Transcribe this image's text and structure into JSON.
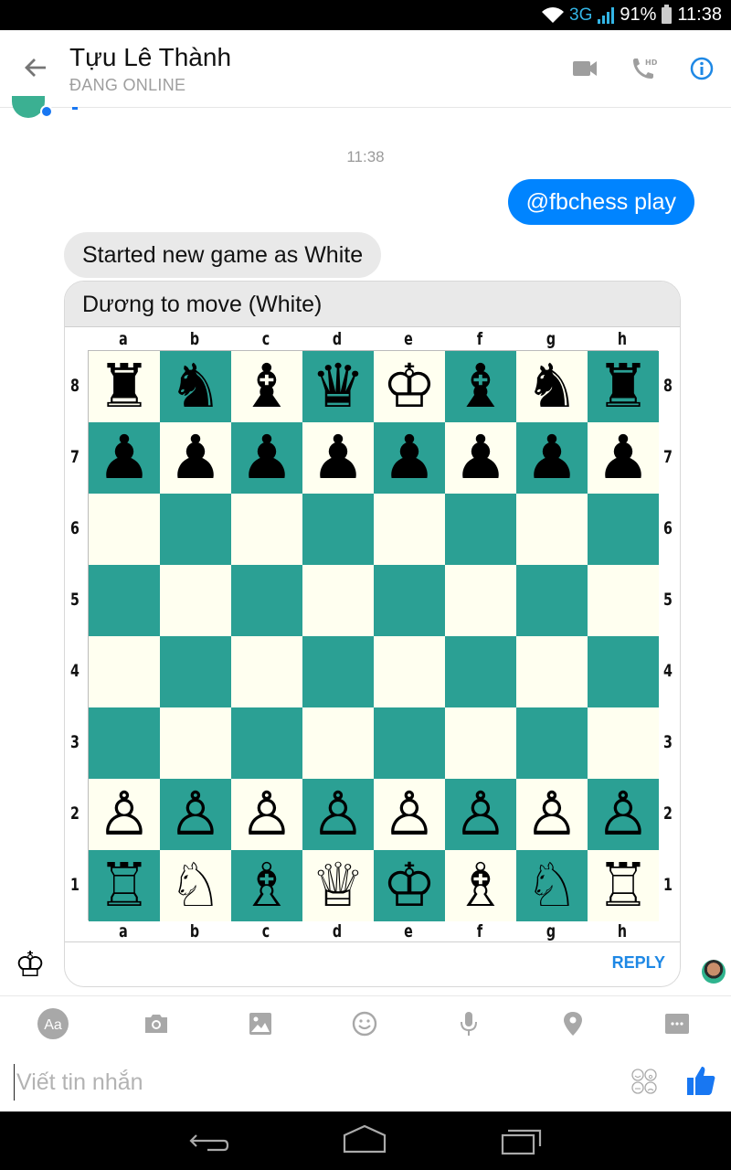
{
  "status_bar": {
    "network": "3G",
    "battery": "91%",
    "time": "11:38"
  },
  "header": {
    "title": "Tựu Lê Thành",
    "subtitle": "ĐANG ONLINE",
    "icons": [
      "back-arrow-icon",
      "video-call-icon",
      "hd-voice-call-icon",
      "info-icon"
    ],
    "accent": "#1e88e5"
  },
  "conversation": {
    "timestamp": "11:38",
    "messages": [
      {
        "from": "me",
        "text": "@fbchess play"
      },
      {
        "from": "bot",
        "text": "Started new game as White"
      }
    ],
    "chess_card": {
      "title": "Dương to move (White)",
      "files": [
        "a",
        "b",
        "c",
        "d",
        "e",
        "f",
        "g",
        "h"
      ],
      "ranks": [
        "8",
        "7",
        "6",
        "5",
        "4",
        "3",
        "2",
        "1"
      ],
      "board": [
        [
          "♜",
          "♞",
          "♝",
          "♛",
          "♔",
          "♝",
          "♞",
          "♜"
        ],
        [
          "♟",
          "♟",
          "♟",
          "♟",
          "♟",
          "♟",
          "♟",
          "♟"
        ],
        [
          "",
          "",
          "",
          "",
          "",
          "",
          "",
          ""
        ],
        [
          "",
          "",
          "",
          "",
          "",
          "",
          "",
          ""
        ],
        [
          "",
          "",
          "",
          "",
          "",
          "",
          "",
          ""
        ],
        [
          "",
          "",
          "",
          "",
          "",
          "",
          "",
          ""
        ],
        [
          "♙",
          "♙",
          "♙",
          "♙",
          "♙",
          "♙",
          "♙",
          "♙"
        ],
        [
          "♖",
          "♘",
          "♗",
          "♕",
          "♔",
          "♗",
          "♘",
          "♖"
        ]
      ],
      "light_square_color": "#fffff0",
      "dark_square_color": "#2ba094",
      "reply_label": "REPLY"
    },
    "sender_avatar_glyph": "♔"
  },
  "composer": {
    "tools": [
      "text-format-icon",
      "camera-icon",
      "gallery-icon",
      "emoji-icon",
      "microphone-icon",
      "location-icon",
      "more-icon"
    ],
    "tool_labels": {
      "text_format": "Aa"
    },
    "placeholder": "Viết tin nhắn",
    "value": ""
  },
  "colors": {
    "outgoing_bubble": "#0084ff",
    "incoming_bubble": "#e9e9e9",
    "like_button": "#1877f2"
  }
}
